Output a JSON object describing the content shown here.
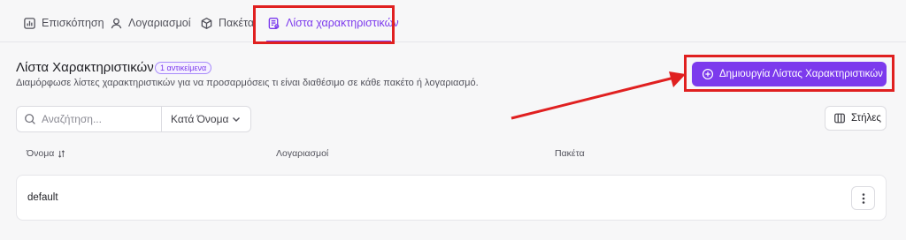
{
  "tabs": [
    {
      "label": "Επισκόπηση",
      "icon": "chart-icon",
      "active": false
    },
    {
      "label": "Λογαριασμοί",
      "icon": "user-icon",
      "active": false
    },
    {
      "label": "Πακέτα",
      "icon": "package-icon",
      "active": false
    },
    {
      "label": "Λίστα χαρακτηριστικών",
      "icon": "feature-list-icon",
      "active": true
    }
  ],
  "header": {
    "title": "Λίστα Χαρακτηριστικών",
    "badge": "1 αντικείμενα",
    "description": "Διαμόρφωσε λίστες χαρακτηριστικών για να προσαρμόσεις τι είναι διαθέσιμο σε κάθε πακέτο ή λογαριασμό.",
    "create_button": "Δημιουργία Λίστας Χαρακτηριστικών"
  },
  "toolbar": {
    "search_placeholder": "Αναζήτηση...",
    "sort_label": "Κατά Όνομα",
    "columns_button": "Στήλες"
  },
  "table": {
    "columns": [
      "Όνομα",
      "Λογαριασμοί",
      "Πακέτα"
    ],
    "rows": [
      {
        "name": "default",
        "accounts": "",
        "packages": ""
      }
    ]
  },
  "colors": {
    "accent": "#7c3aed",
    "annotation": "#e02020"
  }
}
